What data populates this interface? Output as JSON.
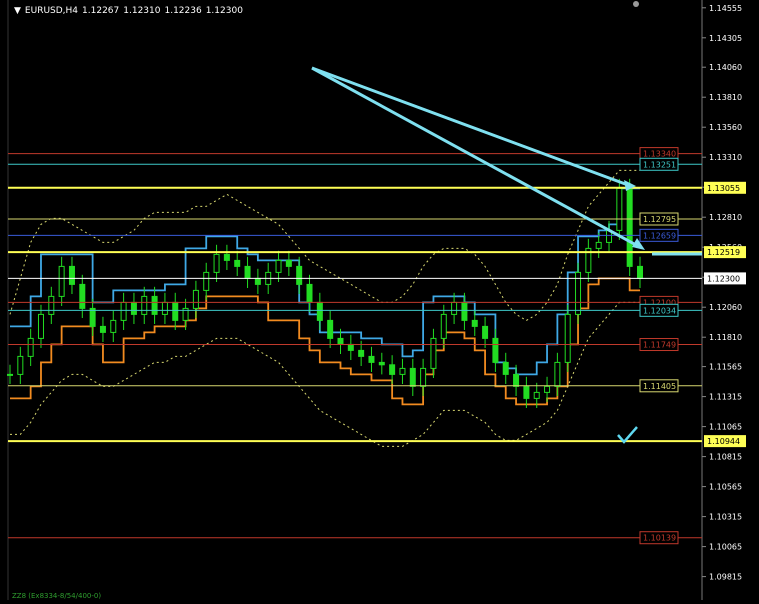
{
  "header": {
    "symbol": "EURUSD,H4",
    "open": "1.12267",
    "high": "1.12310",
    "low": "1.12236",
    "close": "1.12300"
  },
  "footer": "ZZ8 (Ex8334-8/54/400-0)",
  "chart_data": {
    "type": "line",
    "ylim": [
      1.0962,
      1.1462
    ],
    "price_ticks": [
      "1.14555",
      "1.14305",
      "1.14060",
      "1.13810",
      "1.13560",
      "1.13310",
      "1.13060",
      "1.12810",
      "1.12560",
      "1.12310",
      "1.12060",
      "1.11810",
      "1.11565",
      "1.11315",
      "1.11065",
      "1.10815",
      "1.10565",
      "1.10315",
      "1.10065",
      "1.09815"
    ],
    "levels": [
      {
        "label": "1.13340",
        "value": 1.1334,
        "color": "#c0392b"
      },
      {
        "label": "1.13251",
        "value": 1.13251,
        "color": "#3ec9c9"
      },
      {
        "label": "1.13055",
        "value": 1.13055,
        "color": "#ffff55",
        "bold": true
      },
      {
        "label": "1.12795",
        "value": 1.12795,
        "color": "#d8d870"
      },
      {
        "label": "1.12659",
        "value": 1.12659,
        "color": "#3a5bd9"
      },
      {
        "label": "1.12519",
        "value": 1.12519,
        "color": "#ffff55",
        "bold": true
      },
      {
        "label": "1.12300",
        "value": 1.123,
        "color": "#ffffff",
        "current": true
      },
      {
        "label": "1.12100",
        "value": 1.121,
        "color": "#c0392b"
      },
      {
        "label": "1.12034",
        "value": 1.12034,
        "color": "#3ec9c9"
      },
      {
        "label": "1.11749",
        "value": 1.11749,
        "color": "#c0392b"
      },
      {
        "label": "1.11405",
        "value": 1.11405,
        "color": "#d8d870"
      },
      {
        "label": "1.10944",
        "value": 1.10944,
        "color": "#ffff55",
        "bold": true
      },
      {
        "label": "1.10139",
        "value": 1.10139,
        "color": "#c0392b"
      }
    ],
    "close_series": [
      1.115,
      1.1165,
      1.118,
      1.12,
      1.1215,
      1.124,
      1.1225,
      1.1205,
      1.119,
      1.1185,
      1.1195,
      1.121,
      1.12,
      1.1215,
      1.12,
      1.121,
      1.1195,
      1.1205,
      1.122,
      1.1235,
      1.125,
      1.1245,
      1.124,
      1.123,
      1.1225,
      1.1235,
      1.1245,
      1.124,
      1.1225,
      1.121,
      1.1195,
      1.118,
      1.1175,
      1.117,
      1.1165,
      1.116,
      1.1158,
      1.115,
      1.1155,
      1.114,
      1.1155,
      1.118,
      1.12,
      1.121,
      1.1195,
      1.119,
      1.118,
      1.116,
      1.115,
      1.114,
      1.113,
      1.1135,
      1.114,
      1.116,
      1.12,
      1.1235,
      1.1255,
      1.126,
      1.127,
      1.1305,
      1.124,
      1.123
    ],
    "upper_channel": [
      1.119,
      1.119,
      1.1215,
      1.125,
      1.125,
      1.125,
      1.125,
      1.125,
      1.121,
      1.121,
      1.122,
      1.122,
      1.122,
      1.122,
      1.122,
      1.1225,
      1.1225,
      1.1255,
      1.1255,
      1.1265,
      1.1265,
      1.1265,
      1.1255,
      1.125,
      1.1245,
      1.1245,
      1.1245,
      1.1245,
      1.121,
      1.12,
      1.1185,
      1.1185,
      1.1185,
      1.1185,
      1.118,
      1.118,
      1.1175,
      1.1175,
      1.1165,
      1.117,
      1.121,
      1.1215,
      1.1215,
      1.1215,
      1.121,
      1.12,
      1.12,
      1.116,
      1.1155,
      1.115,
      1.115,
      1.116,
      1.1175,
      1.12,
      1.1235,
      1.1265,
      1.1265,
      1.127,
      1.1275,
      1.1305,
      1.1305,
      1.1305
    ],
    "lower_channel": [
      1.113,
      1.113,
      1.114,
      1.116,
      1.1175,
      1.119,
      1.119,
      1.119,
      1.1175,
      1.116,
      1.116,
      1.118,
      1.118,
      1.1185,
      1.119,
      1.119,
      1.119,
      1.1195,
      1.1205,
      1.1215,
      1.1215,
      1.1215,
      1.1215,
      1.1215,
      1.121,
      1.1195,
      1.1195,
      1.1195,
      1.118,
      1.117,
      1.116,
      1.116,
      1.1155,
      1.115,
      1.115,
      1.1145,
      1.1145,
      1.113,
      1.1125,
      1.1125,
      1.115,
      1.117,
      1.1185,
      1.1185,
      1.118,
      1.117,
      1.115,
      1.114,
      1.113,
      1.1125,
      1.1125,
      1.1125,
      1.113,
      1.114,
      1.1175,
      1.1205,
      1.1225,
      1.123,
      1.123,
      1.123,
      1.122,
      1.122
    ],
    "envelope_upper": [
      1.12,
      1.123,
      1.126,
      1.1275,
      1.128,
      1.128,
      1.1275,
      1.127,
      1.1265,
      1.126,
      1.126,
      1.1265,
      1.127,
      1.128,
      1.1285,
      1.1285,
      1.1285,
      1.1285,
      1.129,
      1.129,
      1.1295,
      1.13,
      1.1295,
      1.129,
      1.1285,
      1.128,
      1.1275,
      1.1265,
      1.1255,
      1.1245,
      1.124,
      1.1235,
      1.123,
      1.1225,
      1.122,
      1.1215,
      1.121,
      1.121,
      1.1215,
      1.1225,
      1.124,
      1.125,
      1.1255,
      1.1255,
      1.1255,
      1.125,
      1.124,
      1.1225,
      1.121,
      1.12,
      1.1195,
      1.12,
      1.121,
      1.1225,
      1.125,
      1.127,
      1.129,
      1.13,
      1.131,
      1.132,
      1.132,
      1.132
    ],
    "envelope_lower": [
      1.11,
      1.11,
      1.111,
      1.1125,
      1.1135,
      1.1145,
      1.115,
      1.115,
      1.1145,
      1.114,
      1.114,
      1.1145,
      1.115,
      1.1155,
      1.116,
      1.116,
      1.1165,
      1.1165,
      1.117,
      1.1175,
      1.118,
      1.118,
      1.118,
      1.1175,
      1.117,
      1.1165,
      1.116,
      1.115,
      1.114,
      1.113,
      1.112,
      1.1115,
      1.111,
      1.1105,
      1.11,
      1.1095,
      1.109,
      1.109,
      1.109,
      1.1095,
      1.11,
      1.111,
      1.112,
      1.112,
      1.112,
      1.1115,
      1.111,
      1.11,
      1.1095,
      1.1095,
      1.11,
      1.1105,
      1.111,
      1.112,
      1.114,
      1.116,
      1.118,
      1.119,
      1.12,
      1.121,
      1.121,
      1.121
    ],
    "colors": {
      "candles": "#22dd22",
      "upper_channel": "#3fa9e6",
      "lower_channel": "#f28b20",
      "envelope": "#d8d870",
      "arrows": "#7fe0f0",
      "axis_text": "#ffffff"
    }
  }
}
